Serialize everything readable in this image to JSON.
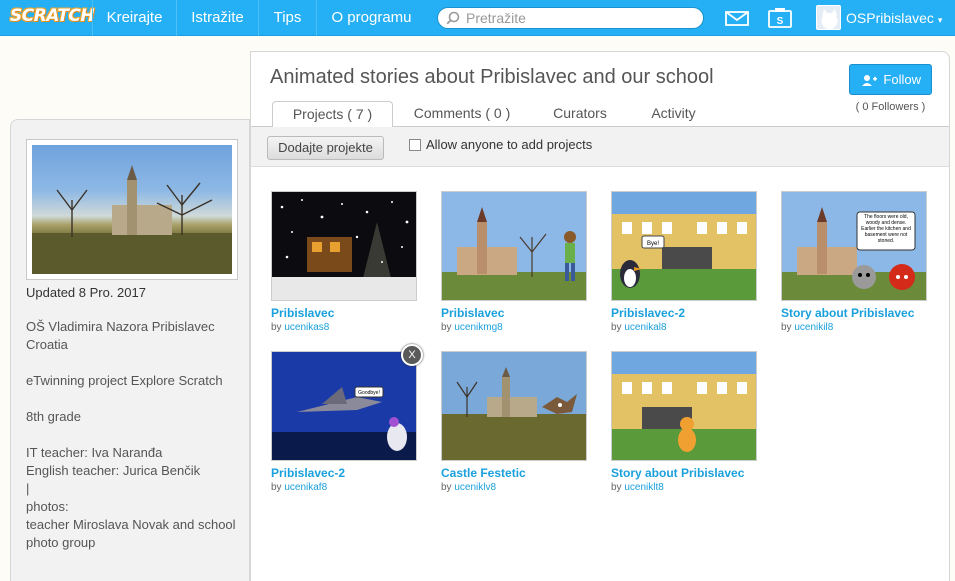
{
  "nav": {
    "logo": "SCRATCH",
    "items": [
      "Kreirajte",
      "Istražite",
      "Tips",
      "O programu"
    ],
    "search_placeholder": "Pretražite",
    "username": "OSPribislavec"
  },
  "studio": {
    "title": "Animated stories about Pribislavec and our school",
    "follow_label": "Follow",
    "followers": "( 0 Followers )",
    "tabs": [
      "Projects ( 7 )",
      "Comments ( 0 )",
      "Curators",
      "Activity"
    ],
    "add_projects_label": "Dodajte projekte",
    "allow_label": "Allow anyone to add projects"
  },
  "sidebar": {
    "updated": "Updated 8 Pro. 2017",
    "desc": [
      "OŠ Vladimira Nazora Pribislavec\nCroatia",
      "eTwinning project Explore Scratch",
      "8th grade",
      "IT teacher: Iva Naranđa\nEnglish teacher: Jurica Benčik\n|\nphotos:\nteacher Miroslava Novak and school photo group"
    ]
  },
  "projects": [
    {
      "title": "Pribislavec",
      "by": "by",
      "author": "ucenikas8",
      "thumb": "snow-night"
    },
    {
      "title": "Pribislavec",
      "by": "by",
      "author": "ucenikmg8",
      "thumb": "castle-girl"
    },
    {
      "title": "Pribislavec-2",
      "by": "by",
      "author": "ucenikal8",
      "thumb": "school-penguin"
    },
    {
      "title": "Story about Pribislavec",
      "by": "by",
      "author": "ucenikil8",
      "thumb": "castle-speech"
    },
    {
      "title": "Pribislavec-2",
      "by": "by",
      "author": "ucenikaf8",
      "thumb": "jet-night"
    },
    {
      "title": "Castle Festetic",
      "by": "by",
      "author": "uceniklv8",
      "thumb": "castle-bat"
    },
    {
      "title": "Story about Pribislavec",
      "by": "by",
      "author": "uceniklt8",
      "thumb": "school-cat"
    }
  ],
  "thumb_texts": {
    "bye": "Bye!",
    "goodbye": "Goodbye!",
    "speech": "The floors were old, woody and dense. Earlier the kitchen and basement were not stoned."
  },
  "remove_label": "X"
}
